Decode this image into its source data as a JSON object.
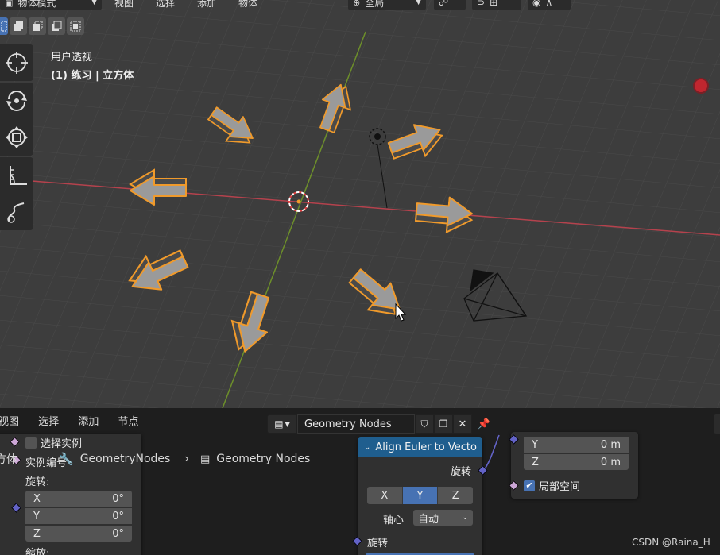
{
  "viewport": {
    "mode_label": "物体模式",
    "menu": [
      "视图",
      "选择",
      "添加",
      "物体"
    ],
    "transform_orientation": "全局",
    "overlay_label": "用户透视",
    "collection_label": "(1) 练习 | 立方体"
  },
  "node_editor": {
    "menu": [
      "视图",
      "选择",
      "添加",
      "节点"
    ],
    "datablock_name": "Geometry Nodes",
    "breadcrumb": {
      "object": "方体",
      "modifier": "GeometryNodes",
      "tree": "Geometry Nodes"
    },
    "instance_node": {
      "select_instance_label": "选择实例",
      "instance_index_label": "实例编号",
      "rotation_label": "旋转:",
      "rot_x_label": "X",
      "rot_x_value": "0°",
      "rot_y_label": "Y",
      "rot_y_value": "0°",
      "rot_z_label": "Z",
      "rot_z_value": "0°",
      "scale_label": "缩放:"
    },
    "align_node": {
      "title": "Align Euler to Vecto",
      "output_label": "旋转",
      "axes": [
        "X",
        "Y",
        "Z"
      ],
      "active_axis": "Y",
      "pivot_label": "轴心",
      "pivot_value": "自动",
      "input_label": "旋转"
    },
    "transform_node": {
      "y_label": "Y",
      "y_value": "0 m",
      "z_label": "Z",
      "z_value": "0 m",
      "local_space_label": "局部空间",
      "local_space_checked": true
    }
  },
  "watermark": "CSDN @Raina_H",
  "colors": {
    "selection_outline": "#f09a2b",
    "x_axis": "#b5424d",
    "y_axis": "#6d8f2a",
    "accent": "#4772b3"
  }
}
